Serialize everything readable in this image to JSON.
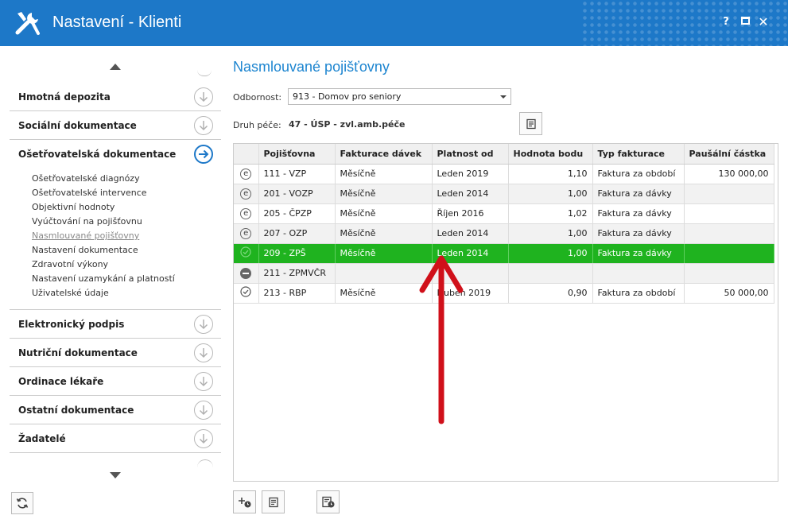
{
  "window": {
    "title": "Nastavení - Klienti",
    "help": "?",
    "close": "✕"
  },
  "sidebar": {
    "sections_top": [
      {
        "label": "Hmotná depozita"
      },
      {
        "label": "Sociální dokumentace"
      },
      {
        "label": "Ošetřovatelská dokumentace",
        "active": true
      }
    ],
    "subitems": [
      "Ošetřovatelské diagnózy",
      "Ošetřovatelské intervence",
      "Objektivní hodnoty",
      "Vyúčtování na pojišťovnu",
      "Nasmlouvané pojišťovny",
      "Nastavení dokumentace",
      "Zdravotní výkony",
      "Nastavení uzamykání a platností",
      "Uživatelské údaje"
    ],
    "current_subitem": "Nasmlouvané pojišťovny",
    "sections_bottom": [
      {
        "label": "Elektronický podpis"
      },
      {
        "label": "Nutriční dokumentace"
      },
      {
        "label": "Ordinace lékaře"
      },
      {
        "label": "Ostatní dokumentace"
      },
      {
        "label": "Žadatelé"
      }
    ]
  },
  "main": {
    "title": "Nasmlouvané pojišťovny",
    "odbornost_label": "Odbornost:",
    "odbornost_value": "913 - Domov pro seniory",
    "druh_label": "Druh péče:",
    "druh_value": "47 - ÚSP - zvl.amb.péče",
    "table": {
      "columns": [
        "",
        "Pojišťovna",
        "Fakturace dávek",
        "Platnost od",
        "Hodnota bodu",
        "Typ fakturace",
        "Paušální částka"
      ],
      "rows": [
        {
          "icon": "e",
          "cells": [
            "111 - VZP",
            "Měsíčně",
            "Leden 2019",
            "1,10",
            "Faktura za období",
            "130 000,00"
          ]
        },
        {
          "icon": "e",
          "cells": [
            "201 - VOZP",
            "Měsíčně",
            "Leden 2014",
            "1,00",
            "Faktura za dávky",
            ""
          ]
        },
        {
          "icon": "e",
          "cells": [
            "205 - ČPZP",
            "Měsíčně",
            "Říjen 2016",
            "1,02",
            "Faktura za dávky",
            ""
          ]
        },
        {
          "icon": "e",
          "cells": [
            "207 - OZP",
            "Měsíčně",
            "Leden 2014",
            "1,00",
            "Faktura za dávky",
            ""
          ]
        },
        {
          "icon": "check",
          "selected": true,
          "cells": [
            "209 - ZPŠ",
            "Měsíčně",
            "Leden 2014",
            "1,00",
            "Faktura za dávky",
            ""
          ]
        },
        {
          "icon": "minus",
          "cells": [
            "211 - ZPMVČR",
            "",
            "",
            "",
            "",
            ""
          ]
        },
        {
          "icon": "check",
          "cells": [
            "213 - RBP",
            "Měsíčně",
            "Duben 2019",
            "0,90",
            "Faktura za období",
            "50 000,00"
          ]
        }
      ]
    }
  },
  "colors": {
    "accent": "#1d78c8",
    "selected_row": "#1fb31f",
    "annotation_arrow": "#d0101a"
  }
}
